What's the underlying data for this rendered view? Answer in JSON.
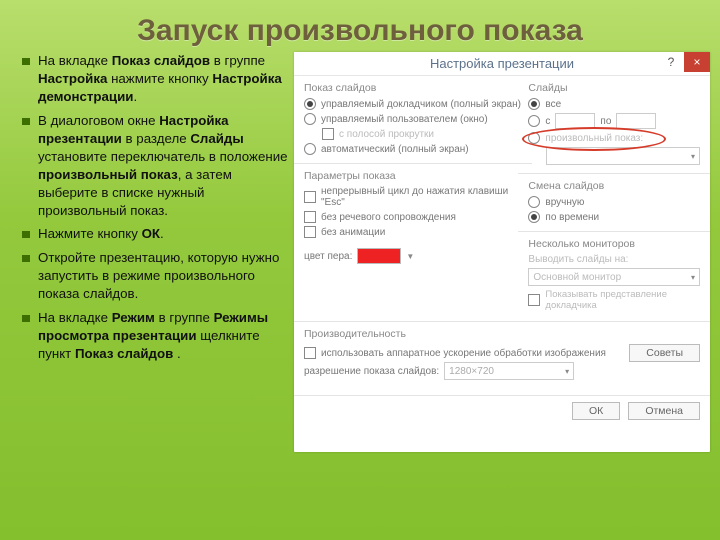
{
  "title": "Запуск произвольного показа",
  "bullets": [
    [
      [
        "На вкладке ",
        0
      ],
      [
        "Показ слайдов",
        1
      ],
      [
        " в группе ",
        0
      ],
      [
        "Настройка",
        1
      ],
      [
        " нажмите кнопку ",
        0
      ],
      [
        "Настройка демонстрации",
        1
      ],
      [
        ".",
        0
      ]
    ],
    [
      [
        "В диалоговом окне ",
        0
      ],
      [
        "Настройка презентации",
        1
      ],
      [
        " в разделе ",
        0
      ],
      [
        "Слайды",
        1
      ],
      [
        " установите переключатель в положение ",
        0
      ],
      [
        "произвольный показ",
        1
      ],
      [
        ", а затем выберите в списке нужный произвольный показ.",
        0
      ]
    ],
    [
      [
        "Нажмите кнопку ",
        0
      ],
      [
        "ОК",
        1
      ],
      [
        ".",
        0
      ]
    ],
    [
      [
        "Откройте презентацию, которую нужно запустить в режиме произвольного показа слайдов.",
        0
      ]
    ],
    [
      [
        "На вкладке ",
        0
      ],
      [
        "Режим",
        1
      ],
      [
        " в группе ",
        0
      ],
      [
        "Режимы просмотра презентации",
        1
      ],
      [
        " щелкните пункт ",
        0
      ],
      [
        "Показ слайдов",
        1
      ],
      [
        " .",
        0
      ]
    ]
  ],
  "dlg": {
    "title": "Настройка презентации",
    "help": "?",
    "close": "×",
    "show_type": {
      "label": "Показ слайдов",
      "r1": "управляемый докладчиком (полный экран)",
      "r2": "управляемый пользователем (окно)",
      "r2a": "с полосой прокрутки",
      "r3": "автоматический (полный экран)"
    },
    "slides": {
      "label": "Слайды",
      "r1": "все",
      "r2_from": "с",
      "r2_to": "по",
      "r3": "произвольный показ:",
      "combo": ""
    },
    "opts": {
      "label": "Параметры показа",
      "c1": "непрерывный цикл до нажатия клавиши \"Esc\"",
      "c2": "без речевого сопровождения",
      "c3": "без анимации",
      "pen": "цвет пера:"
    },
    "advance": {
      "label": "Смена слайдов",
      "r1": "вручную",
      "r2": "по времени"
    },
    "monitors": {
      "label": "Несколько мониторов",
      "out": "Выводить слайды на:",
      "combo": "Основной монитор",
      "presenter": "Показывать представление докладчика"
    },
    "perf": {
      "label": "Производительность",
      "hw": "использовать аппаратное ускорение обработки изображения",
      "res": "разрешение показа слайдов:",
      "res_val": "1280×720",
      "tips": "Советы"
    },
    "ok": "ОК",
    "cancel": "Отмена"
  }
}
